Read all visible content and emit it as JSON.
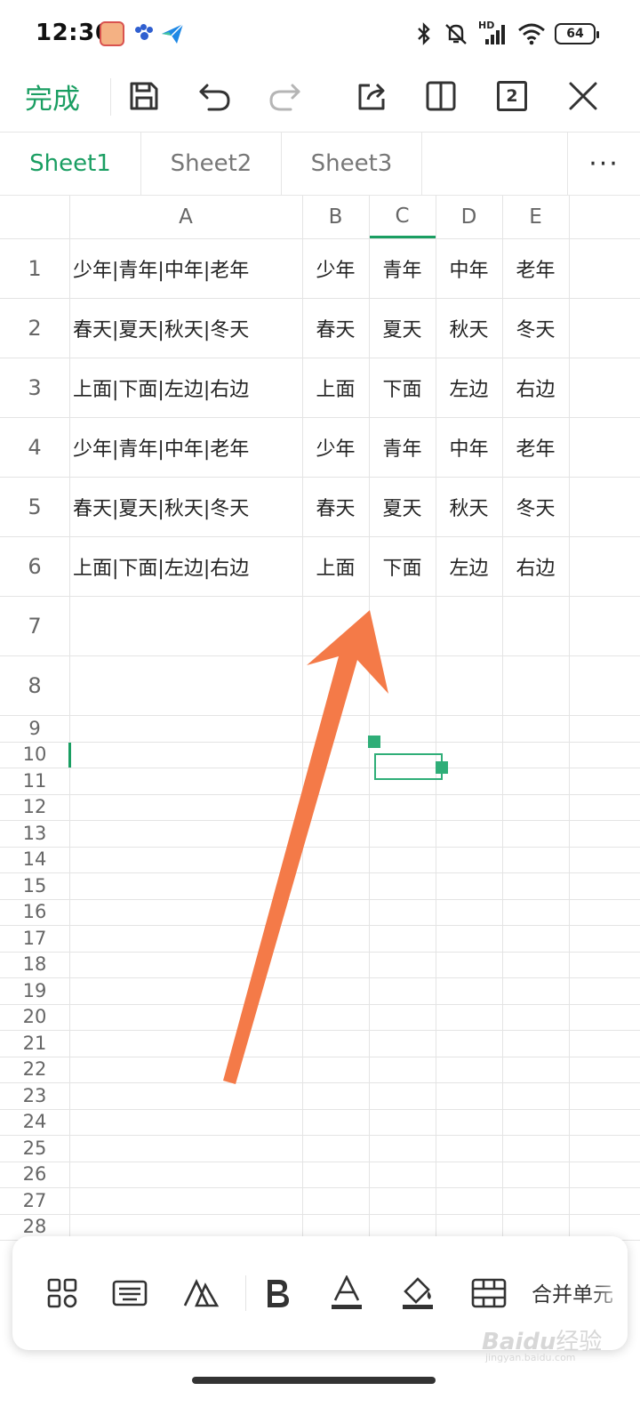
{
  "status": {
    "time": "12:36",
    "battery": "64",
    "signal_label": "HD"
  },
  "toolbar": {
    "done_label": "完成",
    "window_count": "2"
  },
  "tabs": [
    {
      "label": "Sheet1",
      "active": true
    },
    {
      "label": "Sheet2",
      "active": false
    },
    {
      "label": "Sheet3",
      "active": false
    }
  ],
  "tabs_more_label": "···",
  "grid": {
    "columns": [
      "A",
      "B",
      "C",
      "D",
      "E"
    ],
    "active_column": "C",
    "rows": [
      {
        "num": "1",
        "cells": [
          "少年|青年|中年|老年",
          "少年",
          "青年",
          "中年",
          "老年"
        ]
      },
      {
        "num": "2",
        "cells": [
          "春天|夏天|秋天|冬天",
          "春天",
          "夏天",
          "秋天",
          "冬天"
        ]
      },
      {
        "num": "3",
        "cells": [
          "上面|下面|左边|右边",
          "上面",
          "下面",
          "左边",
          "右边"
        ]
      },
      {
        "num": "4",
        "cells": [
          "少年|青年|中年|老年",
          "少年",
          "青年",
          "中年",
          "老年"
        ]
      },
      {
        "num": "5",
        "cells": [
          "春天|夏天|秋天|冬天",
          "春天",
          "夏天",
          "秋天",
          "冬天"
        ]
      },
      {
        "num": "6",
        "cells": [
          "上面|下面|左边|右边",
          "上面",
          "下面",
          "左边",
          "右边"
        ]
      },
      {
        "num": "7",
        "cells": [
          "",
          "",
          "",
          "",
          ""
        ]
      },
      {
        "num": "8",
        "cells": [
          "",
          "",
          "",
          "",
          ""
        ]
      },
      {
        "num": "9",
        "cells": [
          "",
          "",
          "",
          "",
          ""
        ]
      },
      {
        "num": "10",
        "cells": [
          "",
          "",
          "",
          "",
          ""
        ]
      },
      {
        "num": "11",
        "cells": []
      },
      {
        "num": "12",
        "cells": []
      },
      {
        "num": "13",
        "cells": []
      },
      {
        "num": "14",
        "cells": []
      },
      {
        "num": "15",
        "cells": []
      },
      {
        "num": "16",
        "cells": []
      },
      {
        "num": "17",
        "cells": []
      },
      {
        "num": "18",
        "cells": []
      },
      {
        "num": "19",
        "cells": []
      },
      {
        "num": "20",
        "cells": []
      },
      {
        "num": "21",
        "cells": []
      },
      {
        "num": "22",
        "cells": []
      },
      {
        "num": "23",
        "cells": []
      },
      {
        "num": "24",
        "cells": []
      },
      {
        "num": "25",
        "cells": []
      },
      {
        "num": "26",
        "cells": []
      },
      {
        "num": "27",
        "cells": []
      },
      {
        "num": "28",
        "cells": []
      }
    ]
  },
  "format_bar": {
    "merge_label": "合并单元"
  },
  "watermark": {
    "text_main": "Baidu",
    "text_sub": "经验",
    "url": "jingyan.baidu.com"
  },
  "colors": {
    "accent": "#1a9e62",
    "selection": "#2fae78",
    "arrow": "#f47a48"
  }
}
